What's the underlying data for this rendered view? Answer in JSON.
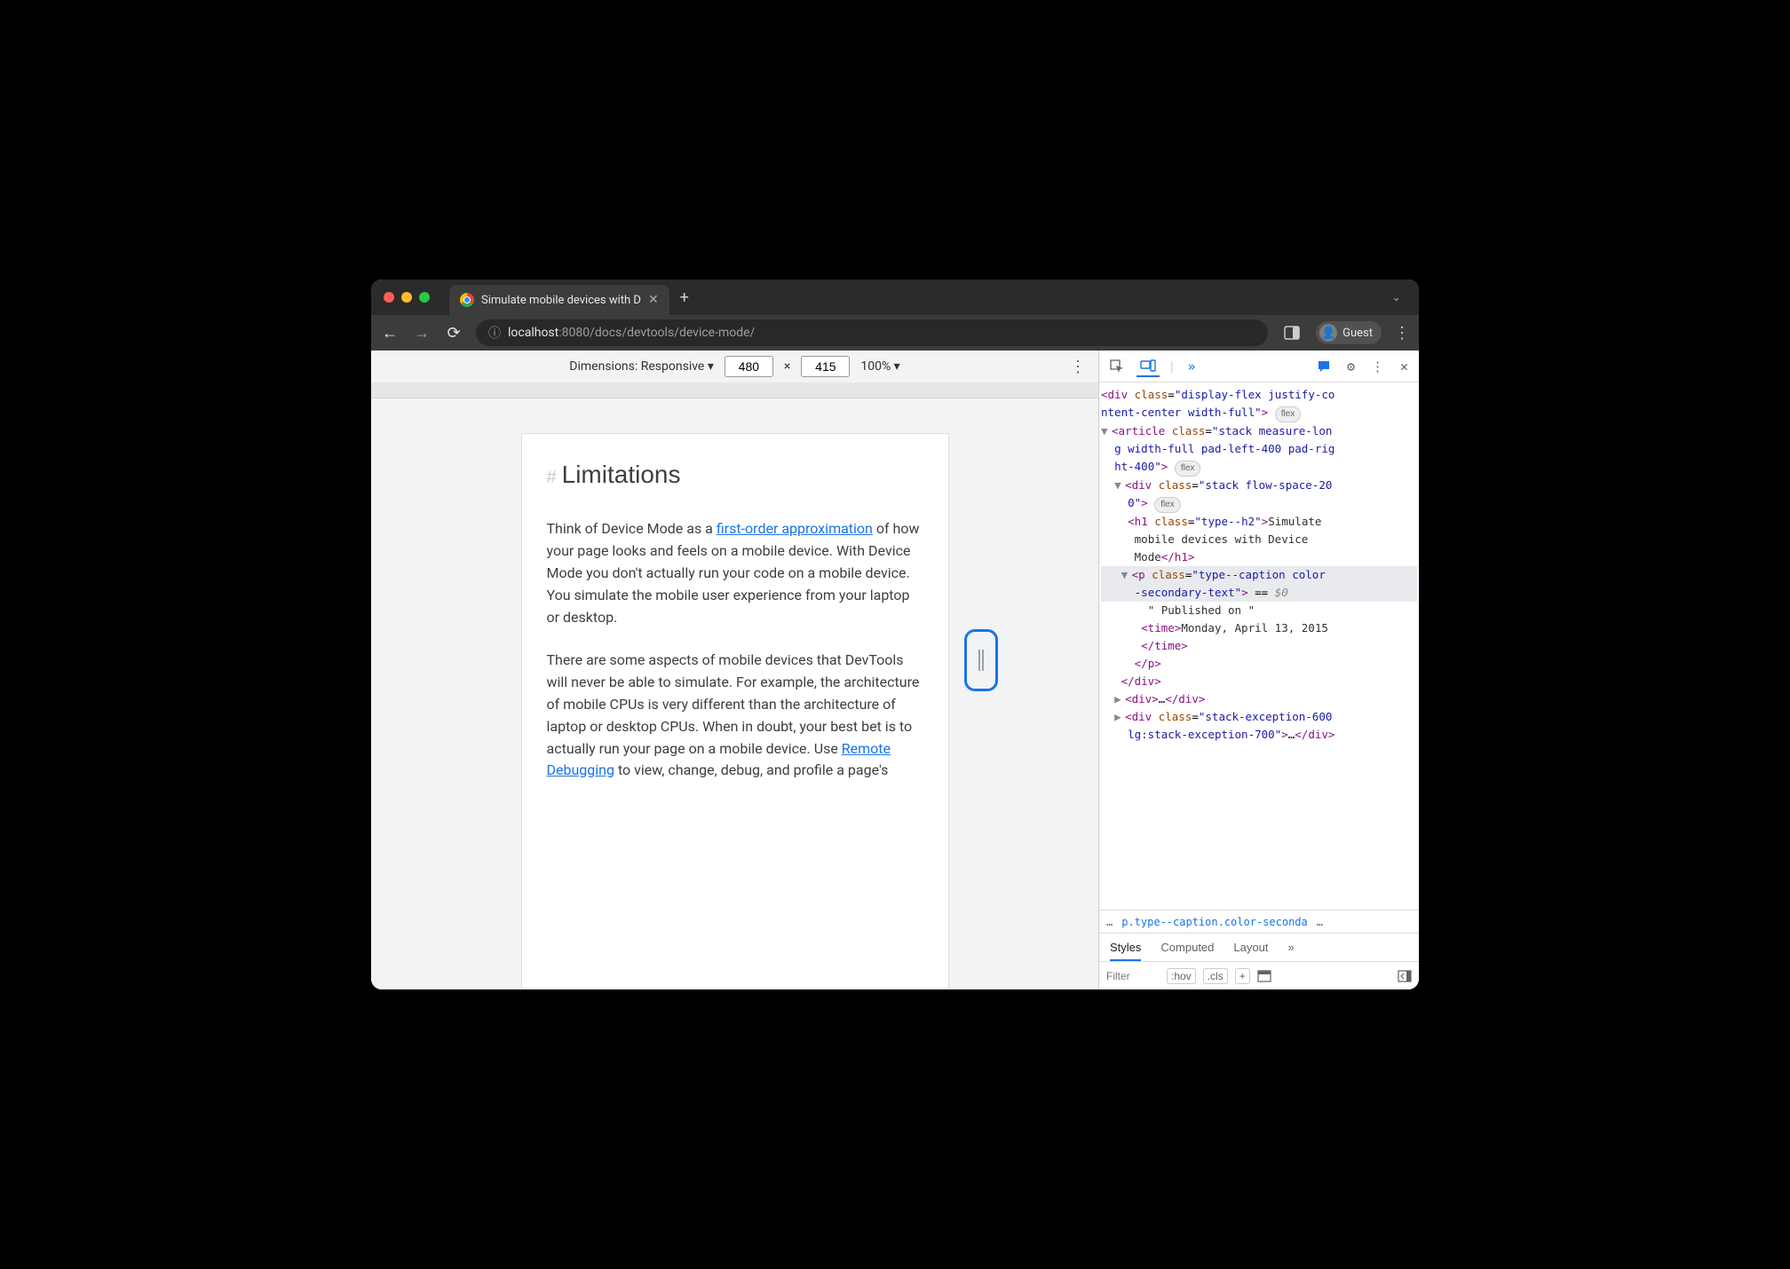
{
  "browser": {
    "tab_title": "Simulate mobile devices with D",
    "url_info_icon": "ⓘ",
    "url_host": "localhost",
    "url_port": ":8080",
    "url_path": "/docs/devtools/device-mode/",
    "profile_name": "Guest"
  },
  "device_toolbar": {
    "dimensions_label": "Dimensions: Responsive ▾",
    "width": "480",
    "times": "×",
    "height": "415",
    "zoom": "100% ▾"
  },
  "page": {
    "heading_hash": "#",
    "heading": "Limitations",
    "p1_a": "Think of Device Mode as a ",
    "p1_link": "first-order approximation",
    "p1_b": " of how your page looks and feels on a mobile device. With Device Mode you don't actually run your code on a mobile device. You simulate the mobile user experience from your laptop or desktop.",
    "p2_a": "There are some aspects of mobile devices that DevTools will never be able to simulate. For example, the architecture of mobile CPUs is very different than the architecture of laptop or desktop CPUs. When in doubt, your best bet is to actually run your page on a mobile device. Use ",
    "p2_link": "Remote Debugging",
    "p2_b": " to view, change, debug, and profile a page's"
  },
  "dom": {
    "l1": "<div class=\"display-flex justify-co",
    "l2": "ntent-center width-full\">",
    "pill_flex": "flex",
    "l3a": "<article class=\"stack measure-lon",
    "l3b": "g width-full pad-left-400 pad-rig",
    "l3c": "ht-400\">",
    "l4a": "<div class=\"stack flow-space-20",
    "l4b": "0\">",
    "l5a": "<h1 class=\"type--h2\">Simulate",
    "l5b": "mobile devices with Device",
    "l5c": "Mode</h1>",
    "l6a": "<p class=\"type--caption color",
    "l6b": "-secondary-text\">",
    "l6eq": " == ",
    "l6dollar": "$0",
    "l7": "\" Published on \"",
    "l8a": "<time>Monday, April 13, 2015",
    "l8b": "</time>",
    "l9": "</p>",
    "l10": "</div>",
    "l11": "<div>…</div>",
    "l12a": "<div class=\"stack-exception-600",
    "l12b": "lg:stack-exception-700\">…</div>"
  },
  "crumbs": {
    "dots": "…",
    "sel": "p.type--caption.color-seconda",
    "dots2": "…"
  },
  "subtabs": {
    "styles": "Styles",
    "computed": "Computed",
    "layout": "Layout",
    "more": "»"
  },
  "styles_bar": {
    "filter_ph": "Filter",
    "hov": ":hov",
    "cls": ".cls",
    "plus": "+"
  }
}
